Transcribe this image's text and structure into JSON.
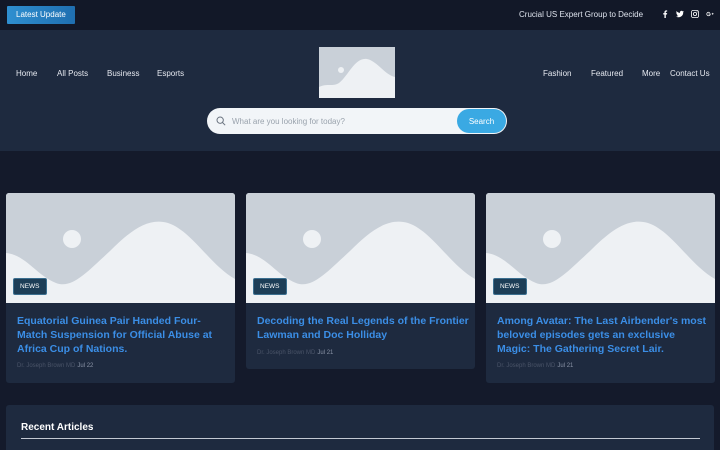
{
  "topbar": {
    "latest_label": "Latest Update",
    "ticker": "Crucial US Expert Group to Decide",
    "socials": [
      "facebook-icon",
      "twitter-icon",
      "instagram-icon",
      "google-plus-icon"
    ]
  },
  "nav_left": [
    "Home",
    "All Posts",
    "Business",
    "Esports"
  ],
  "nav_right": [
    "Fashion",
    "Featured",
    "More",
    "Contact Us"
  ],
  "search": {
    "placeholder": "What are you looking for today?",
    "button_label": "Search"
  },
  "cards": [
    {
      "badge": "NEWS",
      "title": "Equatorial Guinea Pair Handed Four-Match Suspension for Official Abuse at Africa Cup of Nations.",
      "author": "Dr. Joseph Brown MD",
      "date": "Jul 22"
    },
    {
      "badge": "NEWS",
      "title": "Decoding the Real Legends of the Frontier Lawman and Doc Holliday",
      "author": "Dr. Joseph Brown MD",
      "date": "Jul 21"
    },
    {
      "badge": "NEWS",
      "title": "Among Avatar: The Last Airbender's most beloved episodes gets an exclusive Magic: The Gathering Secret Lair.",
      "author": "Dr. Joseph Brown MD",
      "date": "Jul 21"
    }
  ],
  "recent": {
    "title": "Recent Articles"
  },
  "colors": {
    "background": "#141a2b",
    "panel": "#1e2a3f",
    "accent": "#3aa9e3",
    "title_link": "#3b8ee6"
  }
}
